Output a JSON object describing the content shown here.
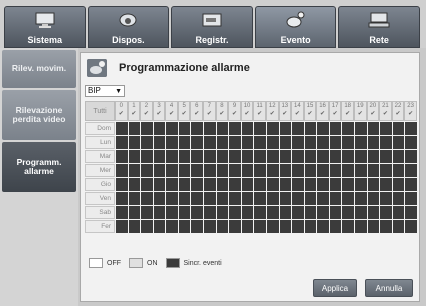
{
  "top_tabs": [
    {
      "label": "Sistema",
      "icon": "monitor-icon",
      "active": false
    },
    {
      "label": "Dispos.",
      "icon": "camera-icon",
      "active": false
    },
    {
      "label": "Registr.",
      "icon": "record-icon",
      "active": false
    },
    {
      "label": "Evento",
      "icon": "event-camera-icon",
      "active": true
    },
    {
      "label": "Rete",
      "icon": "network-icon",
      "active": false
    }
  ],
  "sidebar": {
    "items": [
      {
        "label": "Rilev. movim."
      },
      {
        "label": "Rilevazione perdita video"
      },
      {
        "label": "Programm. allarme"
      }
    ]
  },
  "panel": {
    "title": "Programmazione allarme",
    "dropdown_value": "BIP",
    "corner_label": "Tutti",
    "hours": [
      "0",
      "1",
      "2",
      "3",
      "4",
      "5",
      "6",
      "7",
      "8",
      "9",
      "10",
      "11",
      "12",
      "13",
      "14",
      "15",
      "16",
      "17",
      "18",
      "19",
      "20",
      "21",
      "22",
      "23"
    ],
    "days": [
      "Dom",
      "Lun",
      "Mar",
      "Mer",
      "Gio",
      "Ven",
      "Sab",
      "Fer"
    ],
    "legend": {
      "off": "OFF",
      "on": "ON",
      "sync": "Sincr. eventi"
    }
  },
  "buttons": {
    "apply": "Applica",
    "cancel": "Annulla"
  },
  "colors": {
    "grid_cell": "#3b3b3b",
    "tab_bg": "#5c646e",
    "active_side": "#3e444b"
  }
}
